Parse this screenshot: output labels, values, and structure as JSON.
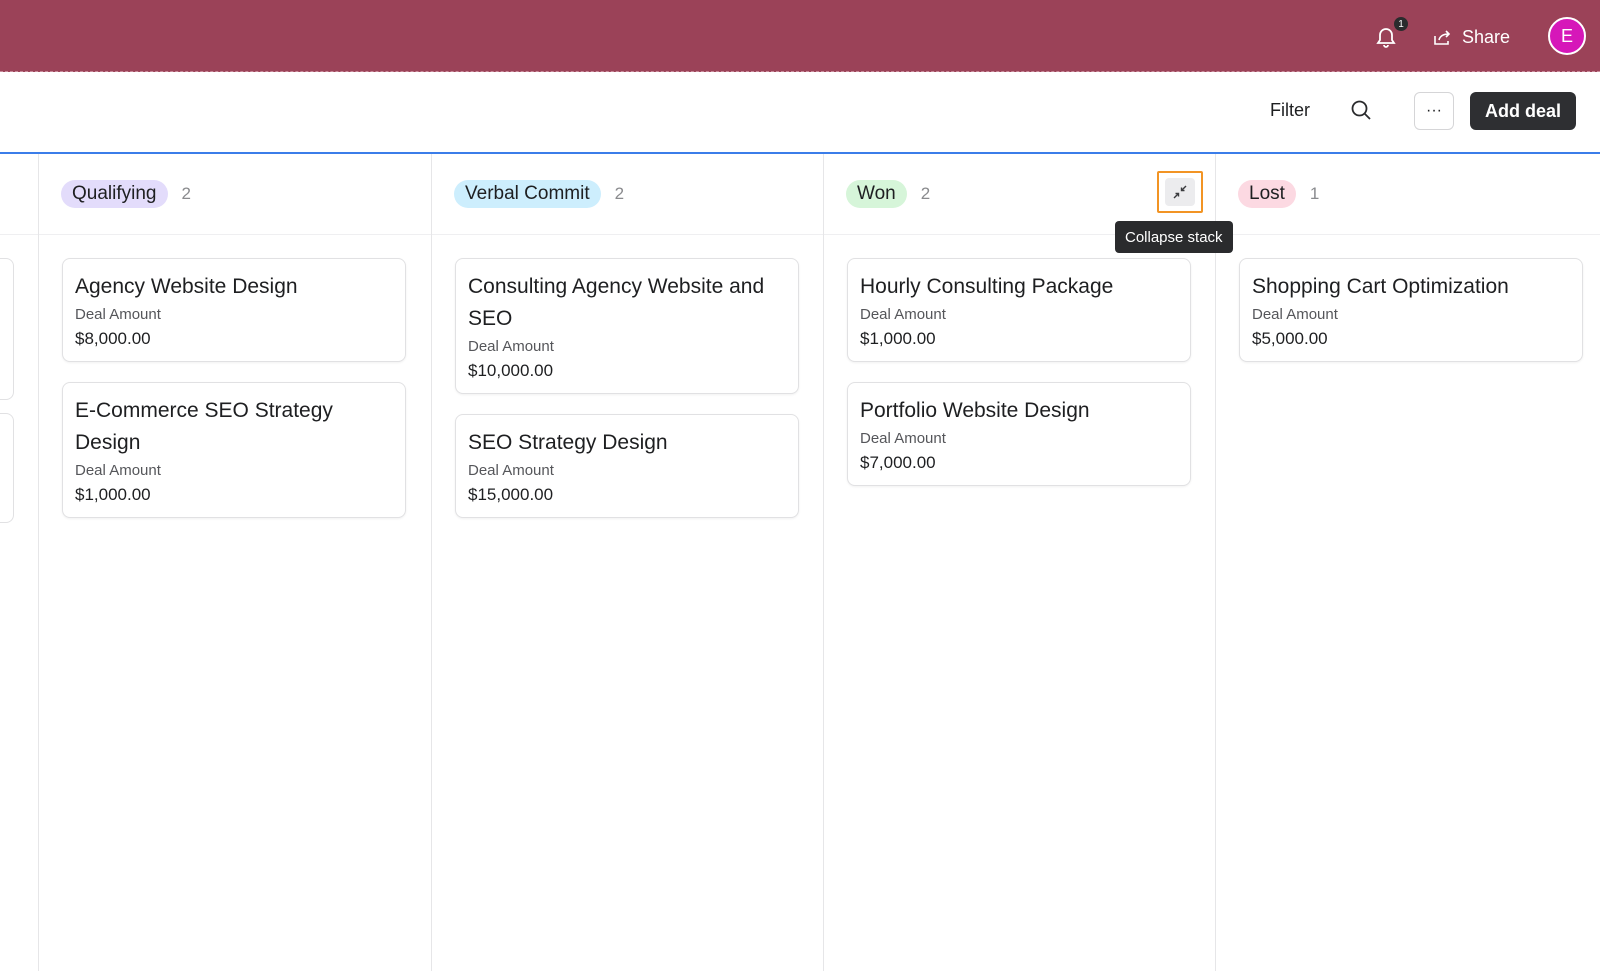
{
  "topbar": {
    "notification_count": "1",
    "share_label": "Share",
    "avatar_initial": "E",
    "bg_color": "#9b4258"
  },
  "toolbar": {
    "filter_label": "Filter",
    "more_label": "···",
    "add_deal_label": "Add deal"
  },
  "tooltip": {
    "collapse_stack": "Collapse stack"
  },
  "columns": [
    {
      "name": "Qualifying",
      "count": "2",
      "pill_color": "#e3dcfb",
      "cards": [
        {
          "title": "Agency Website Design",
          "label": "Deal Amount",
          "amount": "$8,000.00"
        },
        {
          "title": "E-Commerce SEO Strategy Design",
          "label": "Deal Amount",
          "amount": "$1,000.00"
        }
      ]
    },
    {
      "name": "Verbal Commit",
      "count": "2",
      "pill_color": "#cdeefd",
      "cards": [
        {
          "title": "Consulting Agency Website and SEO",
          "label": "Deal Amount",
          "amount": "$10,000.00"
        },
        {
          "title": "SEO Strategy Design",
          "label": "Deal Amount",
          "amount": "$15,000.00"
        }
      ]
    },
    {
      "name": "Won",
      "count": "2",
      "pill_color": "#d6f5d9",
      "cards": [
        {
          "title": "Hourly Consulting Package",
          "label": "Deal Amount",
          "amount": "$1,000.00"
        },
        {
          "title": "Portfolio Website Design",
          "label": "Deal Amount",
          "amount": "$7,000.00"
        }
      ]
    },
    {
      "name": "Lost",
      "count": "1",
      "pill_color": "#fcd9e2",
      "cards": [
        {
          "title": "Shopping Cart Optimization",
          "label": "Deal Amount",
          "amount": "$5,000.00"
        }
      ]
    }
  ]
}
